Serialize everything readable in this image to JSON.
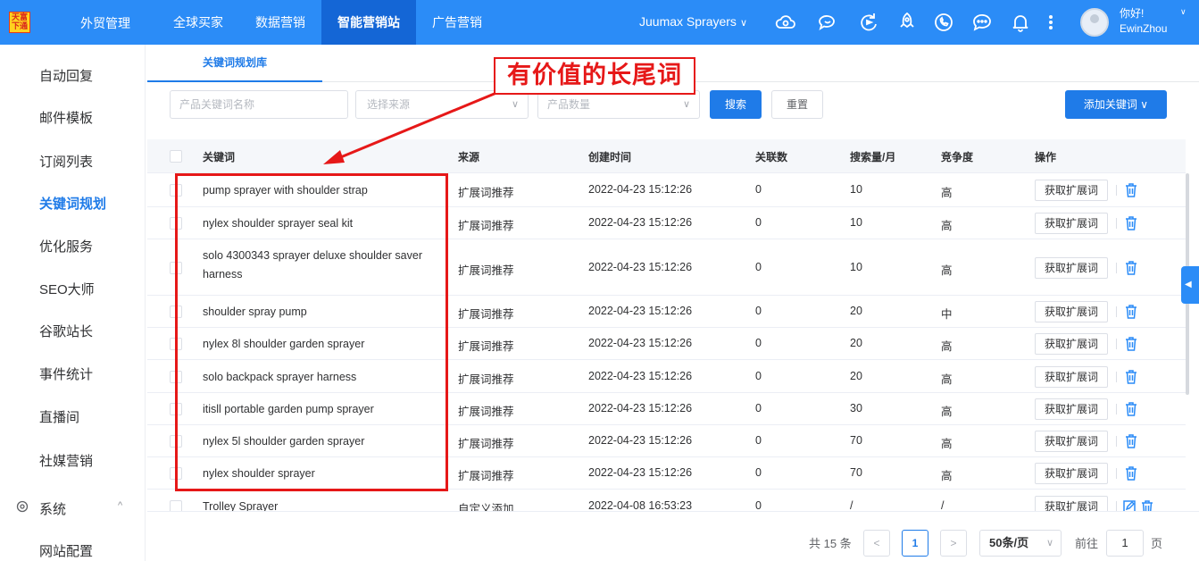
{
  "header": {
    "logo_text": "天富下通",
    "brand": "外贸管理",
    "nav": [
      {
        "label": "全球买家",
        "active": false
      },
      {
        "label": "数据营销",
        "active": false
      },
      {
        "label": "智能营销站",
        "active": true
      },
      {
        "label": "广告营销",
        "active": false
      }
    ],
    "company": "Juumax Sprayers",
    "icons": [
      "cloud-icon",
      "chat-bubble-icon",
      "refresh-icon",
      "rocket-icon",
      "phone-icon",
      "message-icon",
      "bell-icon",
      "more-icon"
    ],
    "greeting": "你好!",
    "username": "EwinZhou"
  },
  "sidebar": {
    "items": [
      {
        "label": "自动回复",
        "active": false
      },
      {
        "label": "邮件模板",
        "active": false
      },
      {
        "label": "订阅列表",
        "active": false
      },
      {
        "label": "关键词规划",
        "active": true
      },
      {
        "label": "优化服务",
        "active": false
      },
      {
        "label": "SEO大师",
        "active": false
      },
      {
        "label": "谷歌站长",
        "active": false
      },
      {
        "label": "事件统计",
        "active": false
      },
      {
        "label": "直播间",
        "active": false
      },
      {
        "label": "社媒营销",
        "active": false
      }
    ],
    "group": {
      "label": "系统",
      "caret": "^"
    },
    "group_items": [
      {
        "label": "网站配置"
      }
    ]
  },
  "tab": {
    "label": "关键词规划库"
  },
  "filters": {
    "keyword_placeholder": "产品关键词名称",
    "source_placeholder": "选择来源",
    "count_placeholder": "产品数量",
    "search_label": "搜索",
    "reset_label": "重置",
    "add_label": "添加关键词"
  },
  "table": {
    "headers": [
      "关键词",
      "来源",
      "创建时间",
      "关联数",
      "搜索量/月",
      "竞争度",
      "操作"
    ],
    "action_label": "获取扩展词",
    "rows": [
      {
        "keyword": "pump sprayer with shoulder strap",
        "source": "扩展词推荐",
        "created": "2022-04-23 15:12:26",
        "related": "0",
        "volume": "10",
        "competition": "高"
      },
      {
        "keyword": "nylex shoulder sprayer seal kit",
        "source": "扩展词推荐",
        "created": "2022-04-23 15:12:26",
        "related": "0",
        "volume": "10",
        "competition": "高"
      },
      {
        "keyword": "solo 4300343 sprayer deluxe shoulder saver harness",
        "source": "扩展词推荐",
        "created": "2022-04-23 15:12:26",
        "related": "0",
        "volume": "10",
        "competition": "高"
      },
      {
        "keyword": "shoulder spray pump",
        "source": "扩展词推荐",
        "created": "2022-04-23 15:12:26",
        "related": "0",
        "volume": "20",
        "competition": "中"
      },
      {
        "keyword": "nylex 8l shoulder garden sprayer",
        "source": "扩展词推荐",
        "created": "2022-04-23 15:12:26",
        "related": "0",
        "volume": "20",
        "competition": "高"
      },
      {
        "keyword": "solo backpack sprayer harness",
        "source": "扩展词推荐",
        "created": "2022-04-23 15:12:26",
        "related": "0",
        "volume": "20",
        "competition": "高"
      },
      {
        "keyword": "itisll portable garden pump sprayer",
        "source": "扩展词推荐",
        "created": "2022-04-23 15:12:26",
        "related": "0",
        "volume": "30",
        "competition": "高"
      },
      {
        "keyword": "nylex 5l shoulder garden sprayer",
        "source": "扩展词推荐",
        "created": "2022-04-23 15:12:26",
        "related": "0",
        "volume": "70",
        "competition": "高"
      },
      {
        "keyword": "nylex shoulder sprayer",
        "source": "扩展词推荐",
        "created": "2022-04-23 15:12:26",
        "related": "0",
        "volume": "70",
        "competition": "高"
      },
      {
        "keyword": "Trolley Sprayer",
        "source": "自定义添加",
        "created": "2022-04-08 16:53:23",
        "related": "0",
        "volume": "/",
        "competition": "/"
      }
    ]
  },
  "pagination": {
    "total": "共 15 条",
    "prev": "<",
    "current": "1",
    "next": ">",
    "page_size": "50条/页",
    "goto_label": "前往",
    "goto_value": "1",
    "page_suffix": "页"
  },
  "annotation": {
    "label": "有价值的长尾词",
    "color": "#e61818"
  }
}
